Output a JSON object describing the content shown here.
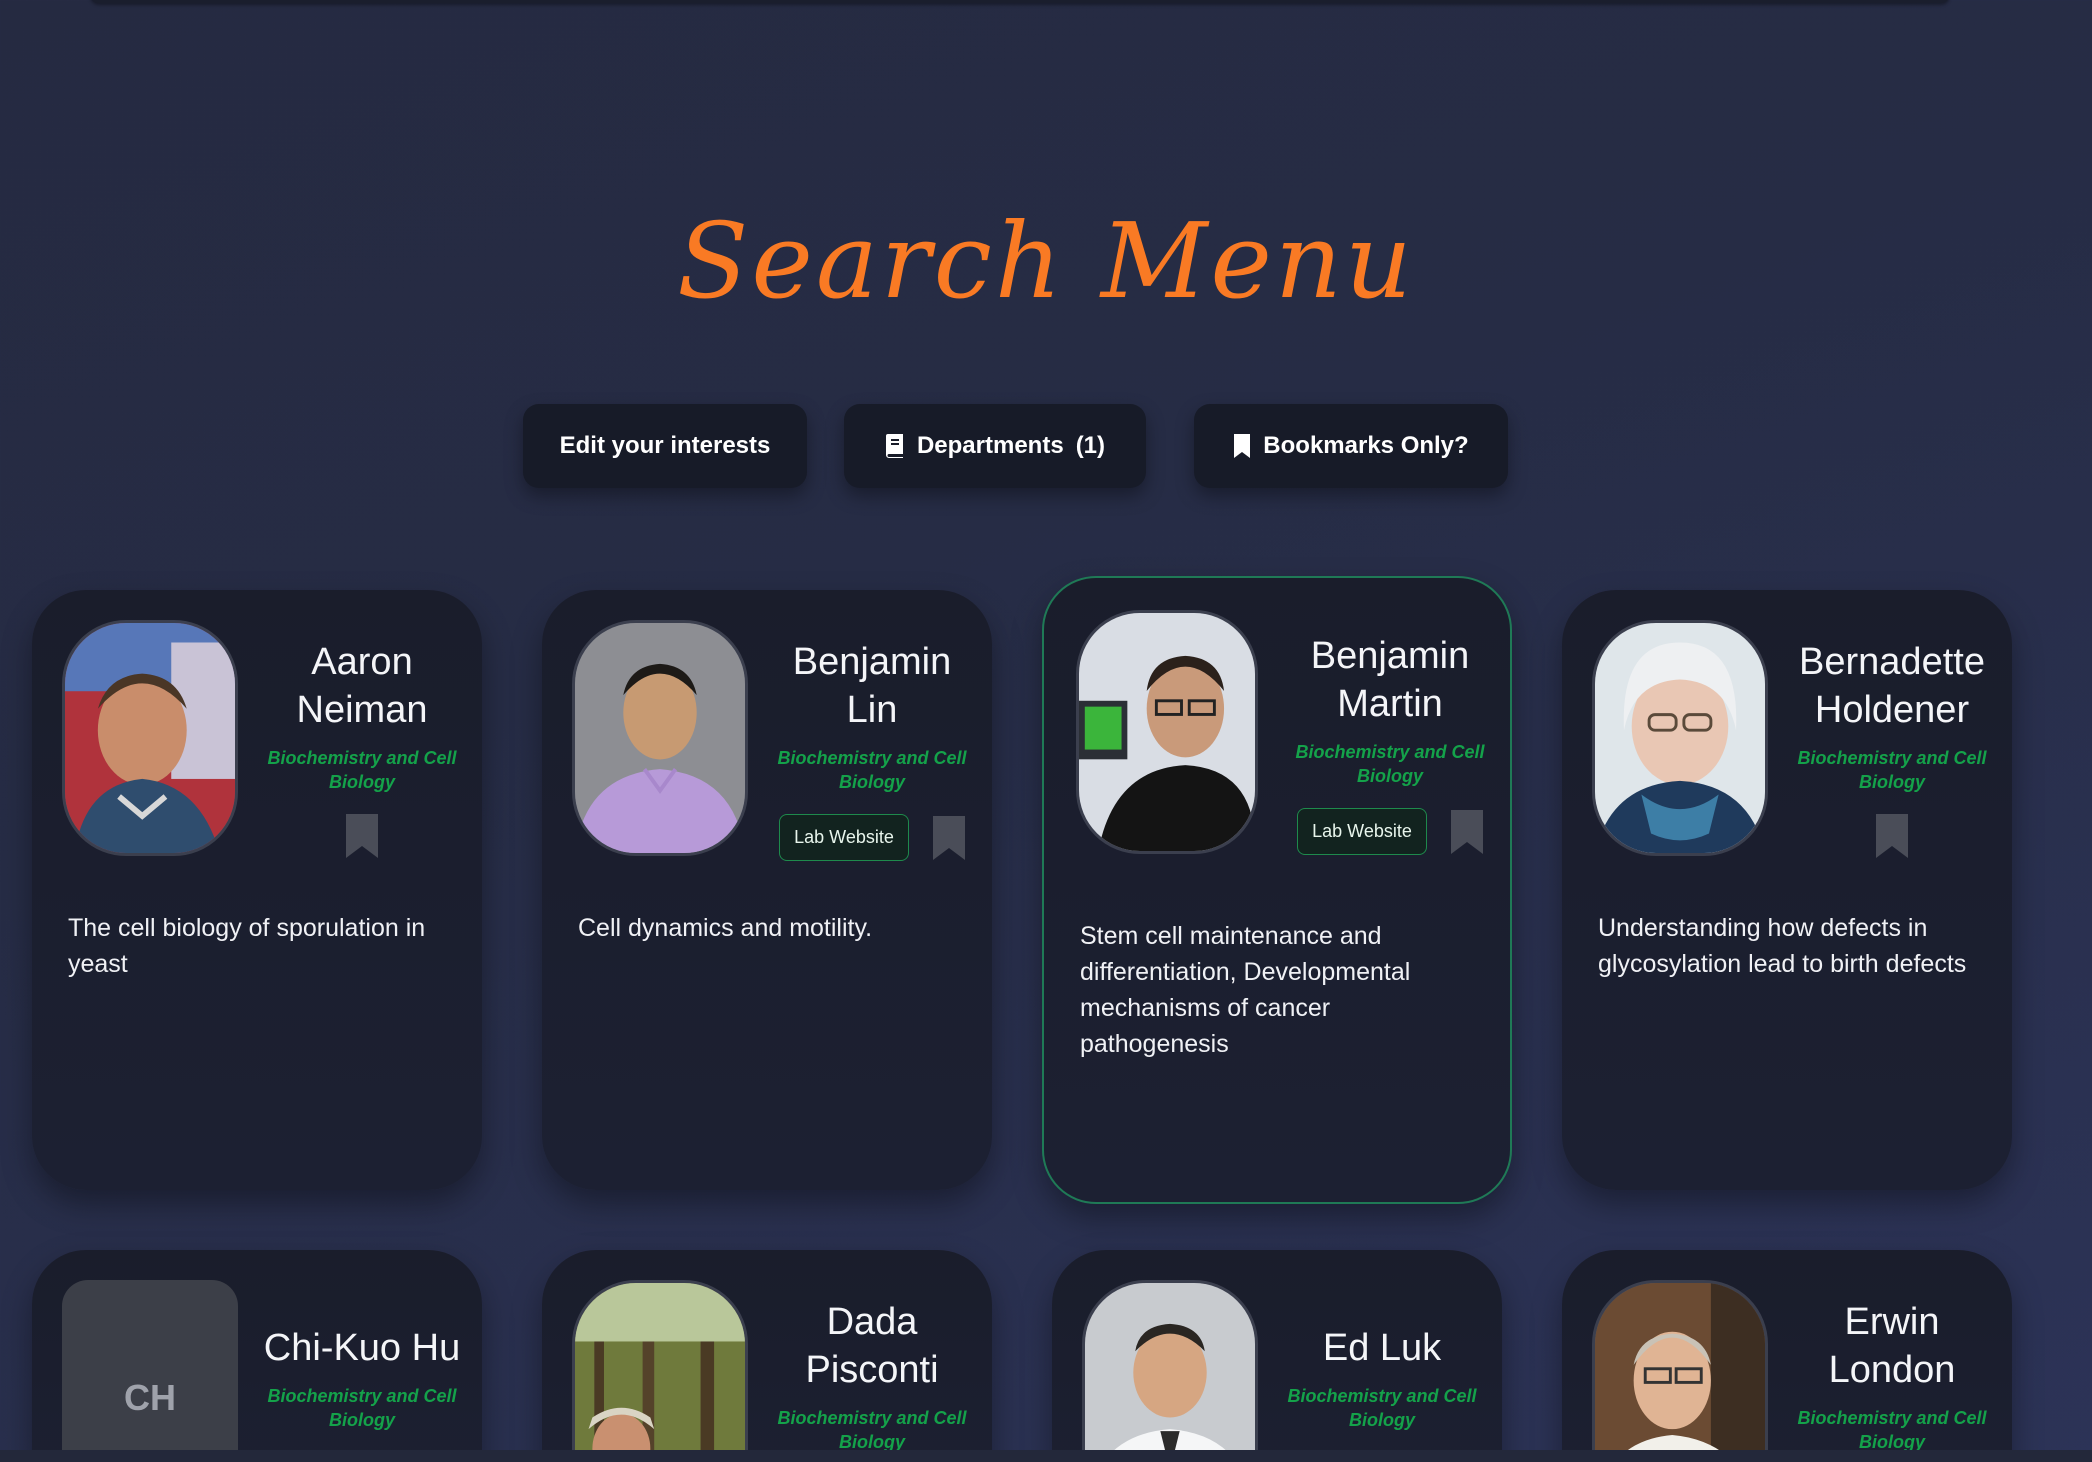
{
  "page": {
    "title": "Search Menu"
  },
  "controls": {
    "edit_interests": "Edit your interests",
    "departments": "Departments",
    "departments_count": "(1)",
    "bookmarks_only": "Bookmarks Only?"
  },
  "colors": {
    "accent_title": "#f97a24",
    "department_green": "#14a24a",
    "card_bg": "#1a1d2b",
    "active_border": "#1f7a56"
  },
  "cards": [
    {
      "name_line1": "Aaron",
      "name_line2": "Neiman",
      "department": "Biochemistry and Cell Biology",
      "lab_website": "",
      "description": "The cell biology of sporulation in yeast",
      "photo": "portrait-photo"
    },
    {
      "name_line1": "Benjamin",
      "name_line2": "Lin",
      "department": "Biochemistry and Cell Biology",
      "lab_website": "Lab Website",
      "description": "Cell dynamics and motility.",
      "photo": "portrait-photo"
    },
    {
      "name_line1": "Benjamin",
      "name_line2": "Martin",
      "department": "Biochemistry and Cell Biology",
      "lab_website": "Lab Website",
      "description": "Stem cell maintenance and differentiation, Developmental mechanisms of cancer pathogenesis",
      "photo": "portrait-photo"
    },
    {
      "name_line1": "Bernadette",
      "name_line2": "Holdener",
      "department": "Biochemistry and Cell Biology",
      "lab_website": "",
      "description": "Understanding how defects in glycosylation lead to birth defects",
      "photo": "portrait-photo"
    },
    {
      "name_line1": "Chi-Kuo Hu",
      "name_line2": "",
      "department": "Biochemistry and Cell Biology",
      "initials": "CH",
      "photo": "initials-placeholder"
    },
    {
      "name_line1": "Dada",
      "name_line2": "Pisconti",
      "department": "Biochemistry and Cell Biology",
      "photo": "portrait-photo"
    },
    {
      "name_line1": "Ed Luk",
      "name_line2": "",
      "department": "Biochemistry and Cell Biology",
      "photo": "portrait-photo"
    },
    {
      "name_line1": "Erwin",
      "name_line2": "London",
      "department": "Biochemistry and Cell Biology",
      "photo": "portrait-photo"
    }
  ],
  "icons": {
    "departments": "book-icon",
    "bookmarks": "bookmark-icon",
    "card_bookmark": "bookmark-icon"
  }
}
